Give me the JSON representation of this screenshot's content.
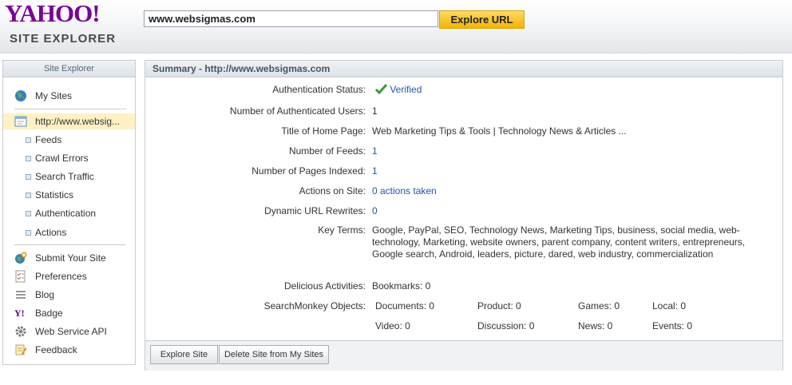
{
  "header": {
    "logo": "YAHOO!",
    "subtitle": "SITE EXPLORER",
    "url_value": "www.websigmas.com",
    "explore_label": "Explore URL"
  },
  "sidebar": {
    "title": "Site Explorer",
    "my_sites": "My Sites",
    "site": "http://www.websig...",
    "sub_items": [
      "Feeds",
      "Crawl Errors",
      "Search Traffic",
      "Statistics",
      "Authentication",
      "Actions"
    ],
    "tools": [
      "Submit Your Site",
      "Preferences",
      "Blog",
      "Badge",
      "Web Service API",
      "Feedback"
    ]
  },
  "summary": {
    "title": "Summary - http://www.websigmas.com",
    "rows": [
      {
        "label": "Authentication Status:",
        "value": "Verified"
      },
      {
        "label": "Number of Authenticated Users:",
        "value": "1"
      },
      {
        "label": "Title of Home Page:",
        "value": "Web Marketing Tips & Tools | Technology News & Articles ..."
      },
      {
        "label": "Number of Feeds:",
        "value": "1"
      },
      {
        "label": "Number of Pages Indexed:",
        "value": "1"
      },
      {
        "label": "Actions on Site:",
        "value": "0 actions taken"
      },
      {
        "label": "Dynamic URL Rewrites:",
        "value": "0"
      },
      {
        "label": "Key Terms:",
        "value": "Google,  PayPal,  SEO,  Technology News,  Marketing Tips,  business,  social media,  web-technology,  Marketing,  website owners,  parent company,  content writers,  entrepreneurs,  Google search,  Android,  leaders,  picture,  dared,  web industry,  commercialization"
      },
      {
        "label": "Delicious Activities:",
        "value": "Bookmarks: 0"
      },
      {
        "label": "SearchMonkey Objects:",
        "value": ""
      }
    ],
    "searchmonkey": [
      "Documents: 0",
      "Product: 0",
      "Games: 0",
      "Local: 0",
      "Video: 0",
      "Discussion: 0",
      "News: 0",
      "Events: 0"
    ],
    "explore_site_label": "Explore Site",
    "delete_label": "Delete Site from My Sites"
  },
  "colors": {
    "logo": "#7b0099",
    "button": "#f4b400",
    "link": "#2255aa",
    "selected": "#fff1c4"
  }
}
